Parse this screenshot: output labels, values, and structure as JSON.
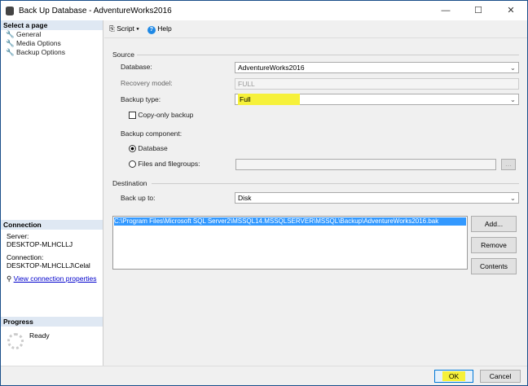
{
  "window": {
    "title": "Back Up Database - AdventureWorks2016",
    "minimize": "—",
    "maximize": "☐",
    "close": "✕"
  },
  "sidebar": {
    "select_page": "Select a page",
    "items": [
      {
        "label": "General"
      },
      {
        "label": "Media Options"
      },
      {
        "label": "Backup Options"
      }
    ],
    "connection": {
      "header": "Connection",
      "server_label": "Server:",
      "server": "DESKTOP-MLHCLLJ",
      "connection_label": "Connection:",
      "connection": "DESKTOP-MLHCLLJ\\Celal",
      "link": "View connection properties"
    },
    "progress": {
      "header": "Progress",
      "status": "Ready"
    }
  },
  "toolbar": {
    "script": "Script",
    "help": "Help"
  },
  "source": {
    "header": "Source",
    "database_label": "Database:",
    "database": "AdventureWorks2016",
    "recovery_label": "Recovery model:",
    "recovery": "FULL",
    "backup_type_label": "Backup type:",
    "backup_type": "Full",
    "copy_only": "Copy-only backup",
    "copy_only_checked": false,
    "component_label": "Backup component:",
    "component_database": "Database",
    "component_files": "Files and filegroups:",
    "selected_component": "Database"
  },
  "destination": {
    "header": "Destination",
    "back_up_to_label": "Back up to:",
    "back_up_to": "Disk",
    "paths": [
      "C:\\Program Files\\Microsoft SQL Server2\\MSSQL14.MSSQLSERVER\\MSSQL\\Backup\\AdventureWorks2016.bak"
    ],
    "add": "Add...",
    "remove": "Remove",
    "contents": "Contents"
  },
  "footer": {
    "ok": "OK",
    "cancel": "Cancel"
  },
  "colors": {
    "highlight": "#f6f13a",
    "selection": "#3399ff"
  }
}
